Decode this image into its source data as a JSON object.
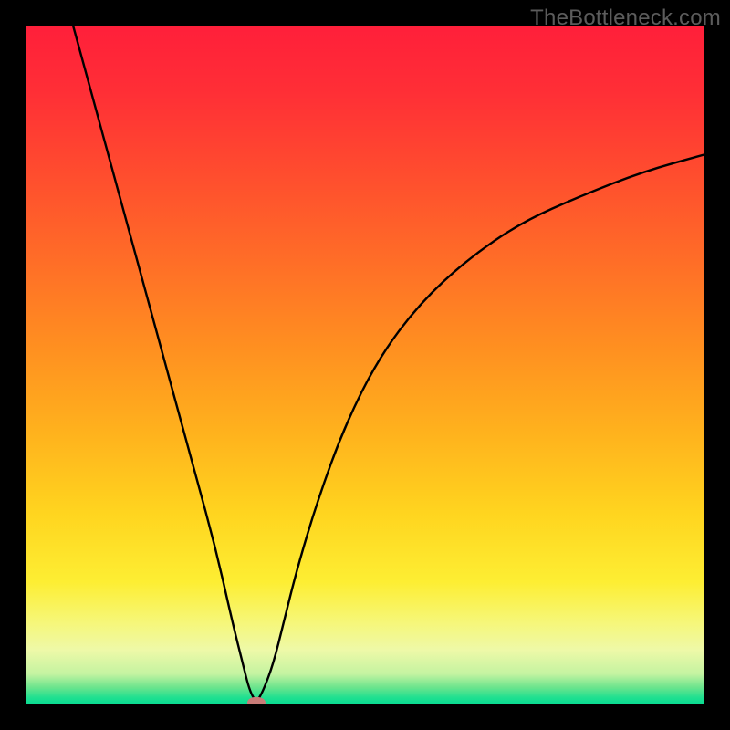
{
  "watermark": "TheBottleneck.com",
  "chart_data": {
    "type": "line",
    "title": "",
    "xlabel": "",
    "ylabel": "",
    "xlim": [
      0,
      100
    ],
    "ylim": [
      0,
      100
    ],
    "grid": false,
    "series": [
      {
        "name": "bottleneck-curve",
        "x": [
          7,
          10,
          13,
          16,
          19,
          22,
          25,
          28,
          30.5,
          32,
          33,
          34,
          35,
          36.5,
          38,
          40,
          43,
          47,
          52,
          58,
          65,
          73,
          82,
          91,
          100
        ],
        "y": [
          100,
          89,
          78,
          67,
          56,
          45,
          34,
          23,
          12,
          6,
          2,
          0.3,
          2,
          6,
          12,
          20,
          30,
          41,
          51,
          59,
          65.5,
          71,
          75,
          78.5,
          81
        ]
      }
    ],
    "min_marker": {
      "x": 34,
      "y": 0.3
    },
    "gradient_stops": [
      {
        "offset": 0.0,
        "color": "#ff1f3a"
      },
      {
        "offset": 0.1,
        "color": "#ff2f36"
      },
      {
        "offset": 0.22,
        "color": "#ff4d2e"
      },
      {
        "offset": 0.35,
        "color": "#ff6e27"
      },
      {
        "offset": 0.48,
        "color": "#ff9120"
      },
      {
        "offset": 0.6,
        "color": "#ffb21d"
      },
      {
        "offset": 0.72,
        "color": "#ffd51f"
      },
      {
        "offset": 0.82,
        "color": "#fdee33"
      },
      {
        "offset": 0.88,
        "color": "#f6f77a"
      },
      {
        "offset": 0.92,
        "color": "#eef9a8"
      },
      {
        "offset": 0.955,
        "color": "#c4f3a1"
      },
      {
        "offset": 0.975,
        "color": "#6be48d"
      },
      {
        "offset": 0.99,
        "color": "#1fe090"
      },
      {
        "offset": 1.0,
        "color": "#07db92"
      }
    ]
  }
}
